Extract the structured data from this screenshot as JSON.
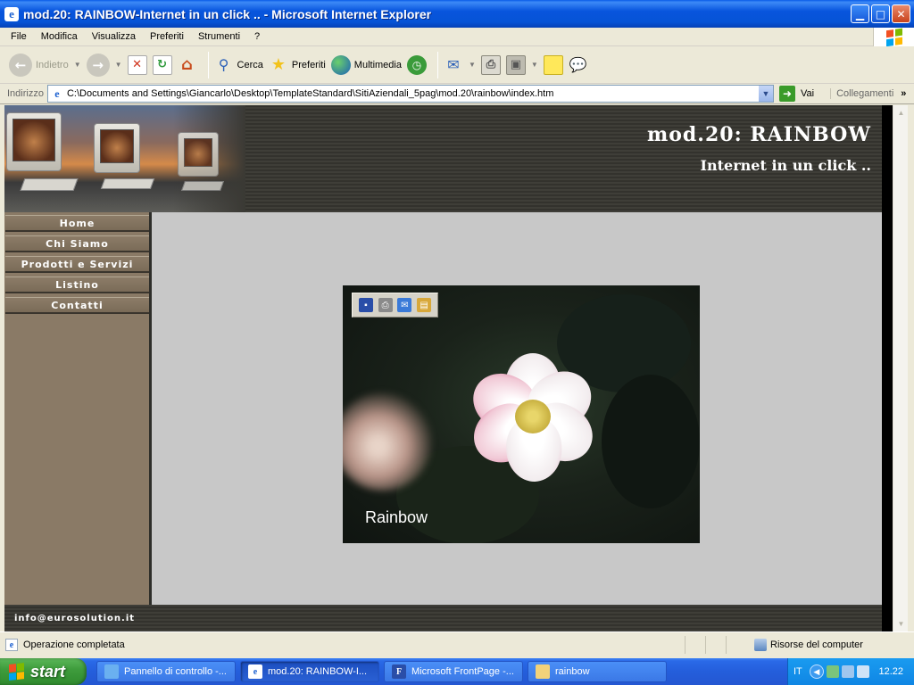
{
  "window": {
    "title": "mod.20: RAINBOW-Internet in un click .. - Microsoft Internet Explorer",
    "minimize_icon": "minimize-icon",
    "maximize_icon": "maximize-icon",
    "close_icon": "close-icon"
  },
  "menu": [
    "File",
    "Modifica",
    "Visualizza",
    "Preferiti",
    "Strumenti",
    "?"
  ],
  "toolbar": {
    "back": "Indietro",
    "search": "Cerca",
    "favorites": "Preferiti",
    "media": "Multimedia"
  },
  "address": {
    "label": "Indirizzo",
    "url": "C:\\Documents and Settings\\Giancarlo\\Desktop\\TemplateStandard\\SitiAziendali_5pag\\mod.20\\rainbow\\index.htm",
    "go": "Vai",
    "links": "Collegamenti"
  },
  "site": {
    "title": "mod.20: RAINBOW",
    "subtitle": "Internet in un click ..",
    "nav": [
      "Home",
      "Chi Siamo",
      "Prodotti e Servizi",
      "Listino",
      "Contatti"
    ],
    "footer_email": "info@eurosolution.it",
    "image_caption": "Rainbow"
  },
  "status": {
    "text": "Operazione completata",
    "zone": "Risorse del computer"
  },
  "taskbar": {
    "start": "start",
    "tasks": [
      "Pannello di controllo -...",
      "mod.20: RAINBOW-I...",
      "Microsoft FrontPage -...",
      "rainbow"
    ],
    "language": "IT",
    "clock": "12.22"
  },
  "colors": {
    "titlebar": "#0855dd",
    "sidebar": "#8a7a66",
    "content_bg": "#c8c8c8",
    "header_bg": "#3f3e38"
  }
}
